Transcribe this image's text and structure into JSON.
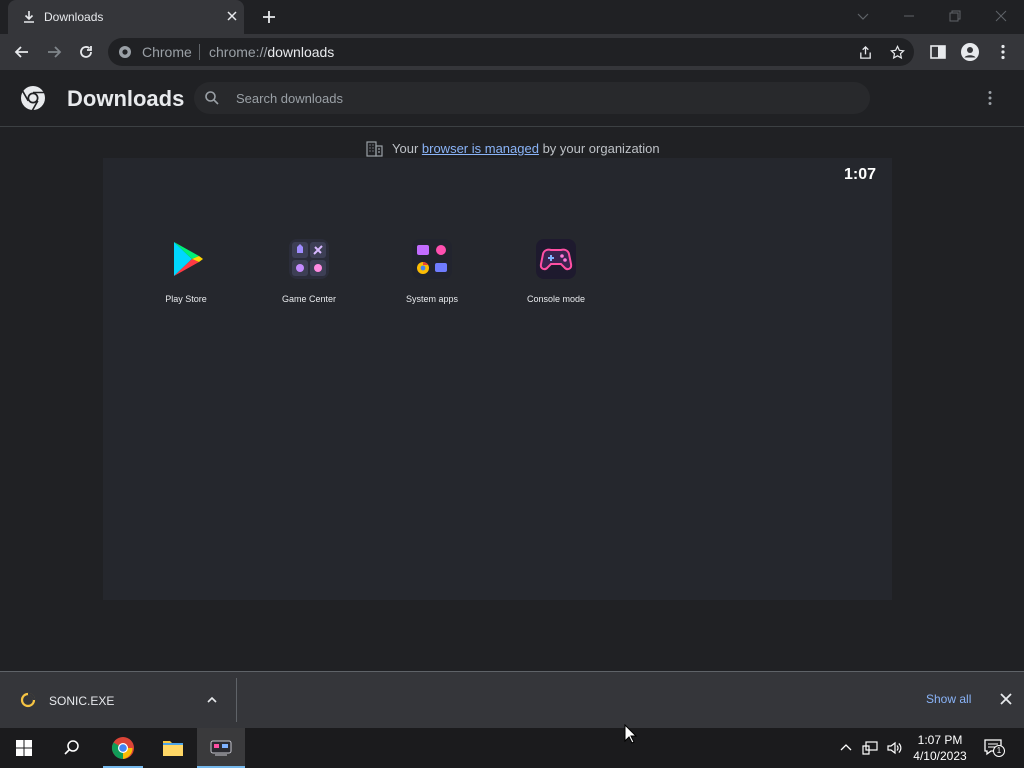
{
  "tab": {
    "title": "Downloads"
  },
  "omnibox": {
    "chip": "Chrome",
    "url_scheme": "chrome://",
    "url_host": "downloads"
  },
  "downloads": {
    "title": "Downloads",
    "search_placeholder": "Search downloads",
    "managed_prefix": "Your ",
    "managed_link": "browser is managed",
    "managed_suffix": " by your organization"
  },
  "overlay": {
    "clock": "1:07",
    "apps": [
      {
        "label": "Play Store",
        "icon": "play-store-icon"
      },
      {
        "label": "Game Center",
        "icon": "game-center-icon"
      },
      {
        "label": "System apps",
        "icon": "system-apps-icon"
      },
      {
        "label": "Console mode",
        "icon": "console-mode-icon"
      }
    ]
  },
  "shelf": {
    "file_name": "SONIC.EXE",
    "show_all": "Show all"
  },
  "taskbar": {
    "time": "1:07 PM",
    "date": "4/10/2023",
    "notification_count": "1"
  },
  "colors": {
    "accent_blue": "#8ab4f8",
    "chrome_dark": "#202124",
    "toolbar": "#35363a"
  }
}
